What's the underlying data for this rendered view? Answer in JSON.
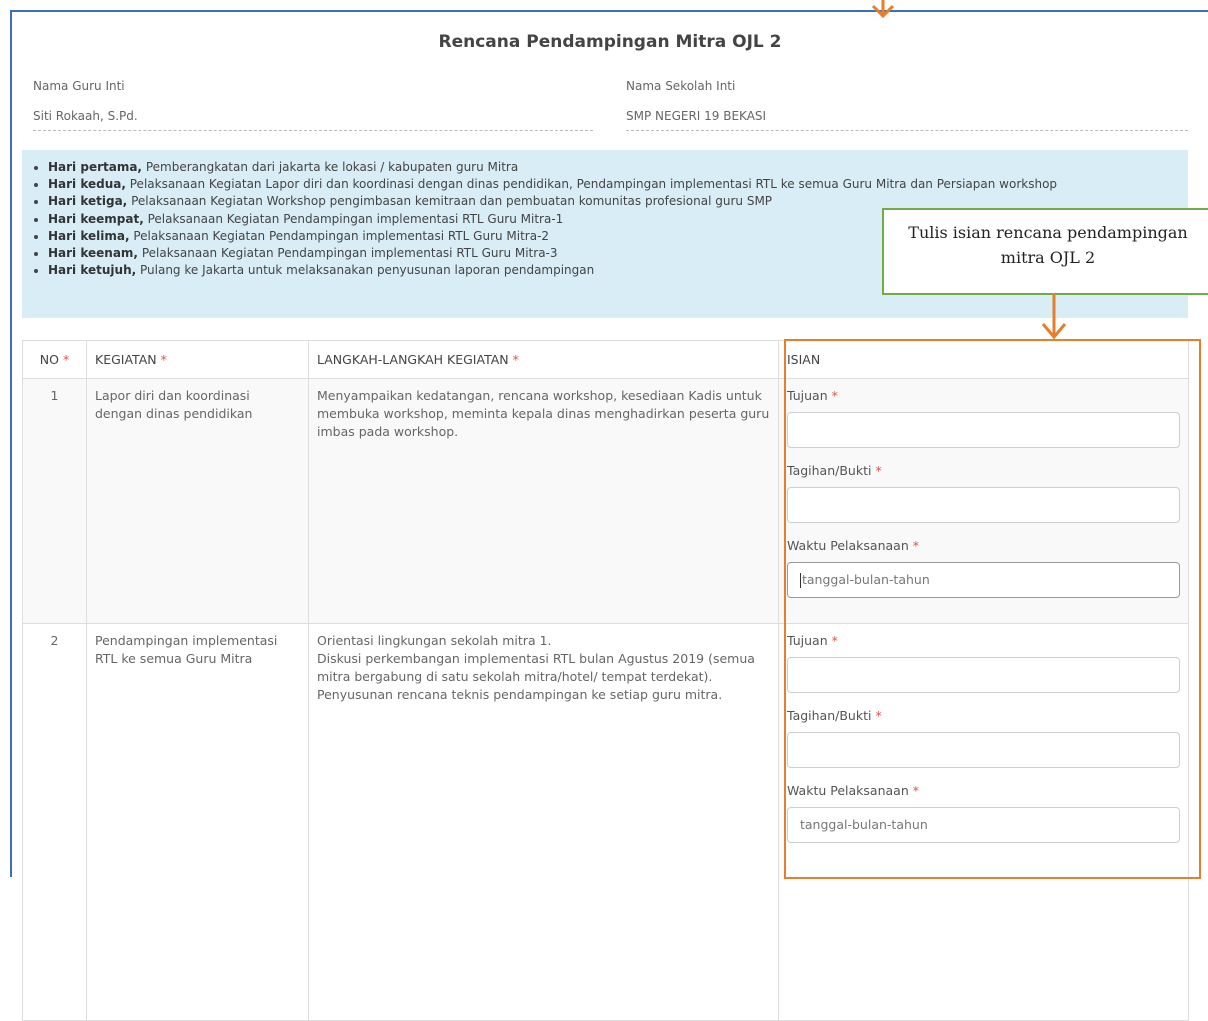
{
  "title": "Rencana Pendampingan Mitra OJL 2",
  "guru_inti": {
    "label": "Nama Guru Inti",
    "value": "Siti Rokaah, S.Pd."
  },
  "sekolah_inti": {
    "label": "Nama Sekolah Inti",
    "value": "SMP NEGERI 19 BEKASI"
  },
  "schedule": [
    {
      "day": "Hari pertama,",
      "text": " Pemberangkatan dari jakarta ke lokasi / kabupaten guru Mitra"
    },
    {
      "day": "Hari kedua,",
      "text": " Pelaksanaan Kegiatan Lapor diri dan koordinasi dengan dinas pendidikan, Pendampingan implementasi RTL ke semua Guru Mitra dan Persiapan workshop"
    },
    {
      "day": "Hari ketiga,",
      "text": " Pelaksanaan Kegiatan Workshop pengimbasan kemitraan dan pembuatan komunitas profesional guru SMP"
    },
    {
      "day": "Hari keempat,",
      "text": " Pelaksanaan Kegiatan Pendampingan implementasi RTL Guru Mitra-1"
    },
    {
      "day": "Hari kelima,",
      "text": " Pelaksanaan Kegiatan Pendampingan implementasi RTL Guru Mitra-2"
    },
    {
      "day": "Hari keenam,",
      "text": " Pelaksanaan Kegiatan Pendampingan implementasi RTL Guru Mitra-3"
    },
    {
      "day": "Hari ketujuh,",
      "text": " Pulang ke Jakarta untuk melaksanakan penyusunan laporan pendampingan"
    }
  ],
  "table": {
    "headers": {
      "no": "NO",
      "kegiatan": "KEGIATAN",
      "langkah": "LANGKAH-LANGKAH KEGIATAN",
      "isian": "ISIAN"
    },
    "required_mark": "*",
    "rows": [
      {
        "no": "1",
        "kegiatan": "Lapor diri dan koordinasi dengan dinas pendidikan",
        "langkah": "Menyampaikan kedatangan, rencana workshop, kesediaan Kadis untuk membuka workshop, meminta kepala dinas menghadirkan peserta guru imbas pada workshop."
      },
      {
        "no": "2",
        "kegiatan": "Pendampingan implementasi RTL ke semua Guru Mitra",
        "langkah_lines": [
          "Orientasi lingkungan sekolah mitra 1.",
          "Diskusi perkembangan implementasi RTL bulan Agustus 2019 (semua mitra bergabung di satu sekolah mitra/hotel/ tempat terdekat).",
          "Penyusunan rencana teknis pendampingan ke setiap guru mitra."
        ]
      }
    ]
  },
  "form": {
    "tujuan_label": "Tujuan",
    "tagihan_label": "Tagihan/Bukti",
    "waktu_label": "Waktu Pelaksanaan",
    "tujuan_value": "",
    "tagihan_value": "",
    "waktu_placeholder": "tanggal-bulan-tahun"
  },
  "callout": {
    "text": "Tulis isian rencana pendampingan mitra OJL 2"
  },
  "colors": {
    "frame": "#3c6fbf",
    "highlight_box": "#e57f2c",
    "callout_border": "#70ad47",
    "info_bg": "#d9edf7",
    "required": "#d9534f"
  }
}
